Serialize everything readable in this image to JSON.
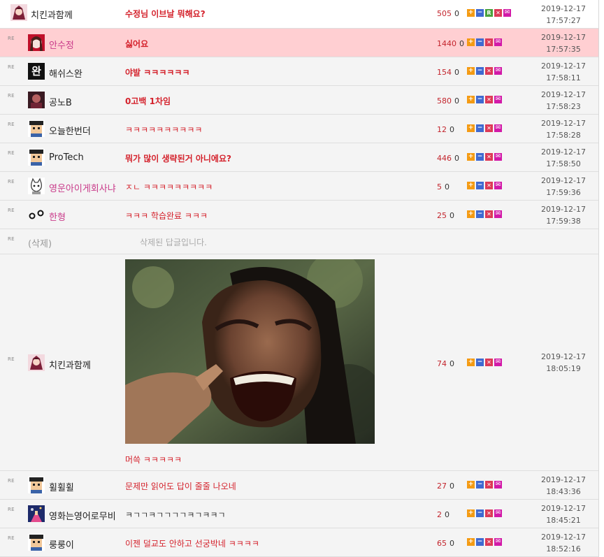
{
  "comments": [
    {
      "re": "",
      "nick": "치킨과함께",
      "text": "수정님 이브날 뭐해요?",
      "up": "505",
      "down": "0",
      "date": "2019-12-17",
      "time": "17:57:27",
      "btn_r": "R"
    },
    {
      "re": "RE",
      "nick": "안수정",
      "text": "싫어요",
      "up": "1440",
      "down": "0",
      "date": "2019-12-17",
      "time": "17:57:35"
    },
    {
      "re": "RE",
      "nick": "해쉬스완",
      "avatar_text": "완",
      "text": "야발 ㅋㅋㅋㅋㅋㅋ",
      "up": "154",
      "down": "0",
      "date": "2019-12-17",
      "time": "17:58:11"
    },
    {
      "re": "RE",
      "nick": "공노B",
      "text": "0고백 1차임",
      "up": "580",
      "down": "0",
      "date": "2019-12-17",
      "time": "17:58:23"
    },
    {
      "re": "RE",
      "nick": "오늘한번더",
      "text": "ㅋㅋㅋㅋㅋㅋㅋㅋㅋㅋ",
      "up": "12",
      "down": "0",
      "date": "2019-12-17",
      "time": "17:58:28"
    },
    {
      "re": "RE",
      "nick": "ProTech",
      "text": "뭐가 많이 생략된거 아니에요?",
      "up": "446",
      "down": "0",
      "date": "2019-12-17",
      "time": "17:58:50"
    },
    {
      "re": "RE",
      "nick": "영운아이게회사냐",
      "text": "ㅈㄴ ㅋㅋㅋㅋㅋㅋㅋㅋㅋ",
      "up": "5",
      "down": "0",
      "date": "2019-12-17",
      "time": "17:59:36"
    },
    {
      "re": "RE",
      "nick": "한형",
      "text": "ㅋㅋㅋ 학습완료 ㅋㅋㅋ",
      "up": "25",
      "down": "0",
      "date": "2019-12-17",
      "time": "17:59:38"
    },
    {
      "re": "RE",
      "nick": "(삭제)",
      "text": "삭제된 답글입니다."
    },
    {
      "re": "RE",
      "nick": "치킨과함께",
      "text": "머쓱 ㅋㅋㅋㅋㅋ",
      "up": "74",
      "down": "0",
      "date": "2019-12-17",
      "time": "18:05:19"
    },
    {
      "re": "RE",
      "nick": "휠휠휠",
      "text": "문제만 읽어도 답이 줄줄 나오네",
      "up": "27",
      "down": "0",
      "date": "2019-12-17",
      "time": "18:43:36"
    },
    {
      "re": "RE",
      "nick": "영화는영어로무비",
      "text": "ㅋㄱㄱㅋㄱㄱㄱㄱㅋㄱㅋㅋㄱ",
      "up": "2",
      "down": "0",
      "date": "2019-12-17",
      "time": "18:45:21"
    },
    {
      "re": "RE",
      "nick": "룽룽이",
      "text": "이젠 덜교도 안하고 선궁박네 ㅋㅋㅋㅋ",
      "up": "65",
      "down": "0",
      "date": "2019-12-17",
      "time": "18:52:16"
    }
  ],
  "colors": {
    "accent_red": "#d4222c",
    "highlight_row": "#ffcfd2",
    "nick_pink": "#c93b8a"
  },
  "icons": [
    "upvote-icon",
    "downvote-icon",
    "reply-icon",
    "report-icon",
    "message-icon",
    "meme-image"
  ]
}
